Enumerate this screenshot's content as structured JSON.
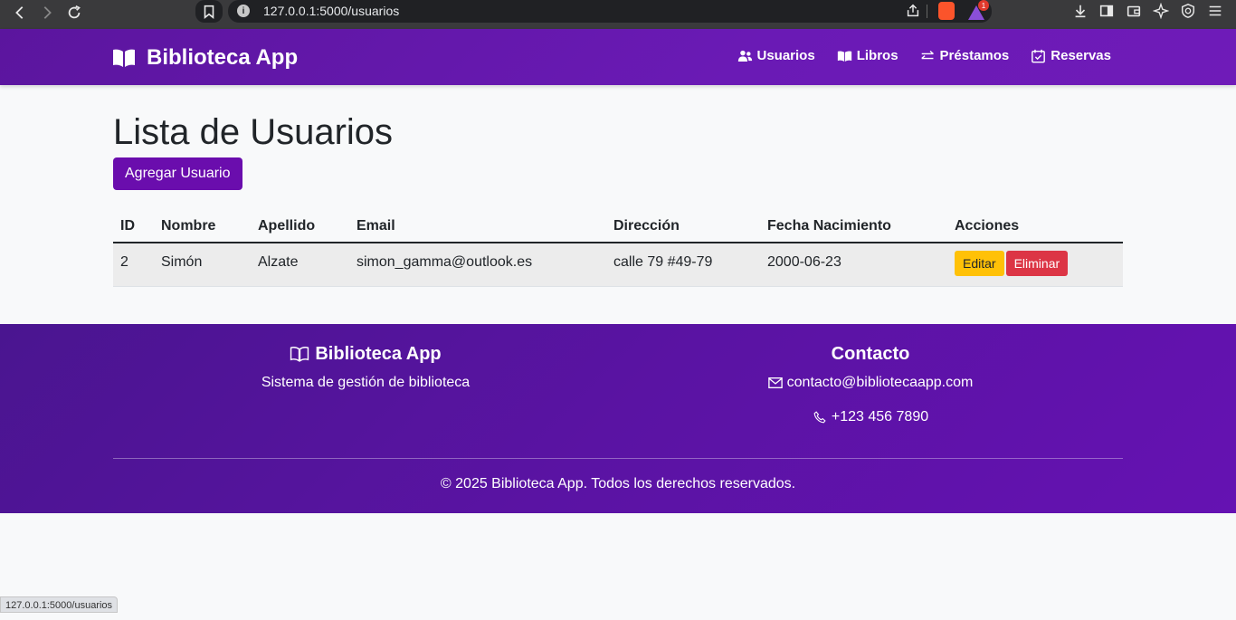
{
  "browser": {
    "url": "127.0.0.1:5000/usuarios",
    "status_url": "127.0.0.1:5000/usuarios",
    "notification_count": "1"
  },
  "navbar": {
    "brand": "Biblioteca App",
    "links": [
      {
        "label": "Usuarios",
        "icon": "users-icon"
      },
      {
        "label": "Libros",
        "icon": "book-icon"
      },
      {
        "label": "Préstamos",
        "icon": "exchange-icon"
      },
      {
        "label": "Reservas",
        "icon": "calendar-check-icon"
      }
    ]
  },
  "main": {
    "title": "Lista de Usuarios",
    "add_button": "Agregar Usuario",
    "table": {
      "headers": [
        "ID",
        "Nombre",
        "Apellido",
        "Email",
        "Dirección",
        "Fecha Nacimiento",
        "Acciones"
      ],
      "rows": [
        {
          "id": "2",
          "nombre": "Simón",
          "apellido": "Alzate",
          "email": "simon_gamma@outlook.es",
          "direccion": "calle 79 #49-79",
          "fecha": "2000-06-23",
          "edit": "Editar",
          "delete": "Eliminar"
        }
      ]
    }
  },
  "footer": {
    "left_title": "Biblioteca App",
    "left_text": "Sistema de gestión de biblioteca",
    "right_title": "Contacto",
    "email": "contacto@bibliotecaapp.com",
    "phone": "+123 456 7890",
    "copyright": "© 2025 Biblioteca App. Todos los derechos reservados."
  },
  "colors": {
    "primary": "#6a0dad",
    "warning": "#ffc107",
    "danger": "#dc3545"
  }
}
